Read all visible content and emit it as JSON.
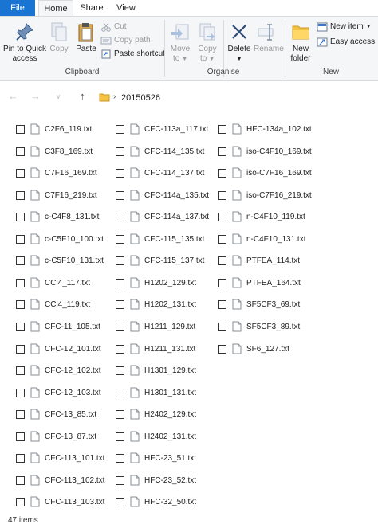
{
  "tabs": {
    "file": "File",
    "home": "Home",
    "share": "Share",
    "view": "View"
  },
  "ribbon": {
    "clipboard": {
      "pin_line1": "Pin to Quick",
      "pin_line2": "access",
      "copy": "Copy",
      "paste": "Paste",
      "cut": "Cut",
      "copy_path": "Copy path",
      "paste_shortcut": "Paste shortcut",
      "label": "Clipboard"
    },
    "organise": {
      "move_to_line1": "Move",
      "move_to_line2": "to",
      "copy_to_line1": "Copy",
      "copy_to_line2": "to",
      "delete": "Delete",
      "rename": "Rename",
      "label": "Organise"
    },
    "new": {
      "new_folder_line1": "New",
      "new_folder_line2": "folder",
      "new_item": "New item",
      "easy_access": "Easy access",
      "label": "New"
    }
  },
  "address": {
    "path": "20150526"
  },
  "files": {
    "col1": [
      "C2F6_119.txt",
      "C3F8_169.txt",
      "C7F16_169.txt",
      "C7F16_219.txt",
      "c-C4F8_131.txt",
      "c-C5F10_100.txt",
      "c-C5F10_131.txt",
      "CCl4_117.txt",
      "CCl4_119.txt",
      "CFC-11_105.txt",
      "CFC-12_101.txt",
      "CFC-12_102.txt",
      "CFC-12_103.txt",
      "CFC-13_85.txt",
      "CFC-13_87.txt",
      "CFC-113_101.txt",
      "CFC-113_102.txt",
      "CFC-113_103.txt"
    ],
    "col2": [
      "CFC-113a_117.txt",
      "CFC-114_135.txt",
      "CFC-114_137.txt",
      "CFC-114a_135.txt",
      "CFC-114a_137.txt",
      "CFC-115_135.txt",
      "CFC-115_137.txt",
      "H1202_129.txt",
      "H1202_131.txt",
      "H1211_129.txt",
      "H1211_131.txt",
      "H1301_129.txt",
      "H1301_131.txt",
      "H2402_129.txt",
      "H2402_131.txt",
      "HFC-23_51.txt",
      "HFC-23_52.txt",
      "HFC-32_50.txt"
    ],
    "col3": [
      "HFC-134a_102.txt",
      "iso-C4F10_169.txt",
      "iso-C7F16_169.txt",
      "iso-C7F16_219.txt",
      "n-C4F10_119.txt",
      "n-C4F10_131.txt",
      "PTFEA_114.txt",
      "PTFEA_164.txt",
      "SF5CF3_69.txt",
      "SF5CF3_89.txt",
      "SF6_127.txt"
    ]
  },
  "status": {
    "item_count": "47 items"
  },
  "colors": {
    "accent": "#1a74d2",
    "ribbon_bg": "#f5f6f7",
    "folder": "#f5c242"
  }
}
